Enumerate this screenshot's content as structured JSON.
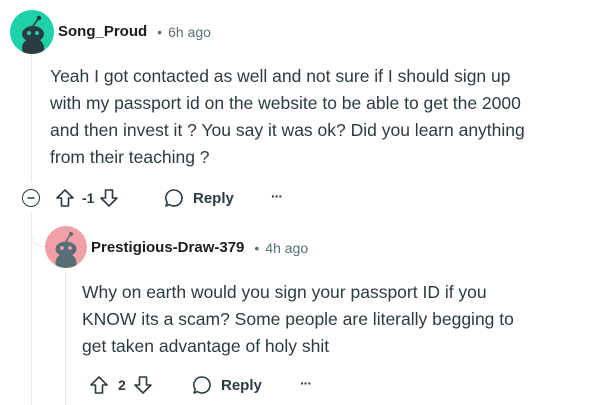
{
  "comment": {
    "username": "Song_Proud",
    "time": "6h ago",
    "body_lines": [
      "Yeah I got contacted as well and not sure if I should sign up",
      "with my passport id on the website to be able to get the 2000",
      "and then invest it ? You say it was ok? Did you learn anything",
      "from their teaching ?"
    ],
    "score": "-1",
    "reply_label": "Reply",
    "more_label": "···",
    "avatar_color": "#1fd1a9"
  },
  "reply": {
    "username": "Prestigious-Draw-379",
    "time": "4h ago",
    "body_lines": [
      "Why on earth would you sign your passport ID if you",
      "KNOW its a scam? Some people are literally begging to",
      "get taken advantage of holy shit"
    ],
    "score": "2",
    "reply_label": "Reply",
    "more_label": "···",
    "avatar_color": "#f2a0a8"
  },
  "separator": "•"
}
